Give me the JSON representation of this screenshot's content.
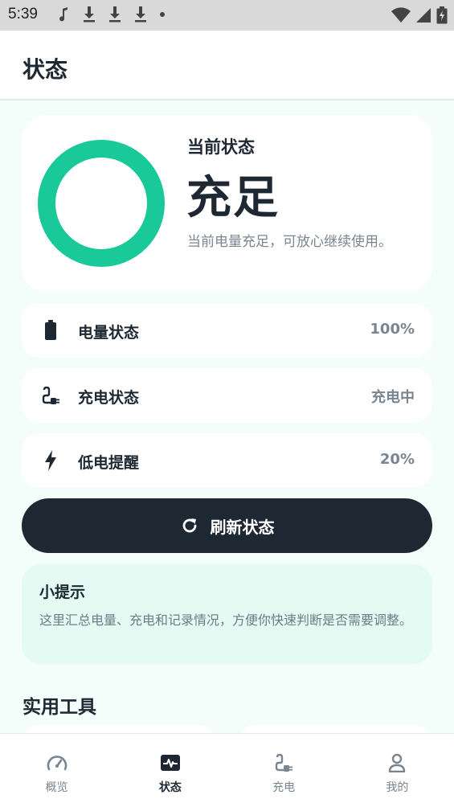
{
  "statusbar": {
    "time": "5:39"
  },
  "appbar": {
    "title": "状态"
  },
  "hero": {
    "label": "当前状态",
    "value": "充足",
    "description": "当前电量充足，可放心继续使用。",
    "ring_level": 1.0,
    "ring_color": "#19c99a"
  },
  "rows": [
    {
      "label": "电量状态",
      "value": "100%",
      "icon": "battery-icon"
    },
    {
      "label": "充电状态",
      "value": "充电中",
      "icon": "plug-icon"
    },
    {
      "label": "低电提醒",
      "value": "20%",
      "icon": "bolt-icon"
    }
  ],
  "refresh": {
    "label": "刷新状态",
    "icon": "refresh-icon"
  },
  "tip": {
    "title": "小提示",
    "body": "这里汇总电量、充电和记录情况，方便你快速判断是否需要调整。"
  },
  "tools": {
    "title": "实用工具"
  },
  "nav": [
    {
      "label": "概览",
      "icon": "gauge-icon",
      "active": false
    },
    {
      "label": "状态",
      "icon": "pulse-icon",
      "active": true
    },
    {
      "label": "充电",
      "icon": "plug-icon",
      "active": false
    },
    {
      "label": "我的",
      "icon": "person-icon",
      "active": false
    }
  ],
  "colors": {
    "accent": "#19c99a",
    "dark": "#1e2833",
    "background": "#f3fdf9",
    "tip_bg": "#e3fbf2"
  }
}
